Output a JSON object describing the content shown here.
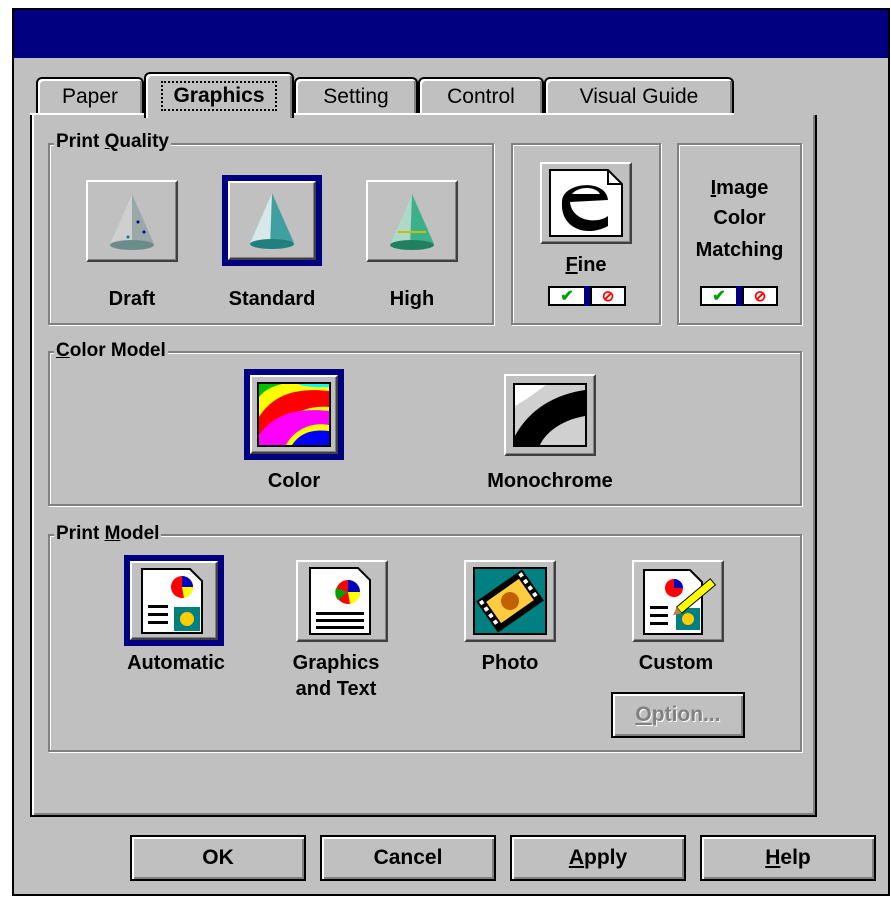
{
  "window": {
    "title": ""
  },
  "tabs": [
    {
      "label": "Paper"
    },
    {
      "label": "Graphics"
    },
    {
      "label": "Setting"
    },
    {
      "label": "Control"
    },
    {
      "label": "Visual Guide"
    }
  ],
  "print_quality": {
    "legend_pre": "Print ",
    "legend_key": "Q",
    "legend_post": "uality",
    "options": [
      {
        "label": "Draft",
        "selected": false
      },
      {
        "label": "Standard",
        "selected": true
      },
      {
        "label": "High",
        "selected": false
      }
    ]
  },
  "fine": {
    "label_key": "F",
    "label_rest": "ine",
    "toggle_on": "✔",
    "toggle_off": "⊘"
  },
  "image_color_matching": {
    "line1_key": "I",
    "line1_rest": "mage",
    "line2": "Color",
    "line3": "Matching",
    "toggle_on": "✔",
    "toggle_off": "⊘"
  },
  "color_model": {
    "legend_key": "C",
    "legend_rest": "olor Model",
    "options": [
      {
        "label": "Color",
        "selected": true
      },
      {
        "label": "Monochrome",
        "selected": false
      }
    ]
  },
  "print_model": {
    "legend_pre": "Print ",
    "legend_key": "M",
    "legend_post": "odel",
    "options": [
      {
        "label": "Automatic",
        "selected": true
      },
      {
        "label_line1": "Graphics",
        "label_line2": "and Text",
        "selected": false
      },
      {
        "label": "Photo",
        "selected": false
      },
      {
        "label": "Custom",
        "selected": false
      }
    ],
    "option_button_key": "O",
    "option_button_rest": "ption..."
  },
  "buttons": {
    "ok": "OK",
    "cancel": "Cancel",
    "apply_key": "A",
    "apply_rest": "pply",
    "help_key": "H",
    "help_rest": "elp"
  },
  "colors": {
    "titlebar": "#000080",
    "face": "#c0c0c0",
    "selection": "#000080"
  }
}
